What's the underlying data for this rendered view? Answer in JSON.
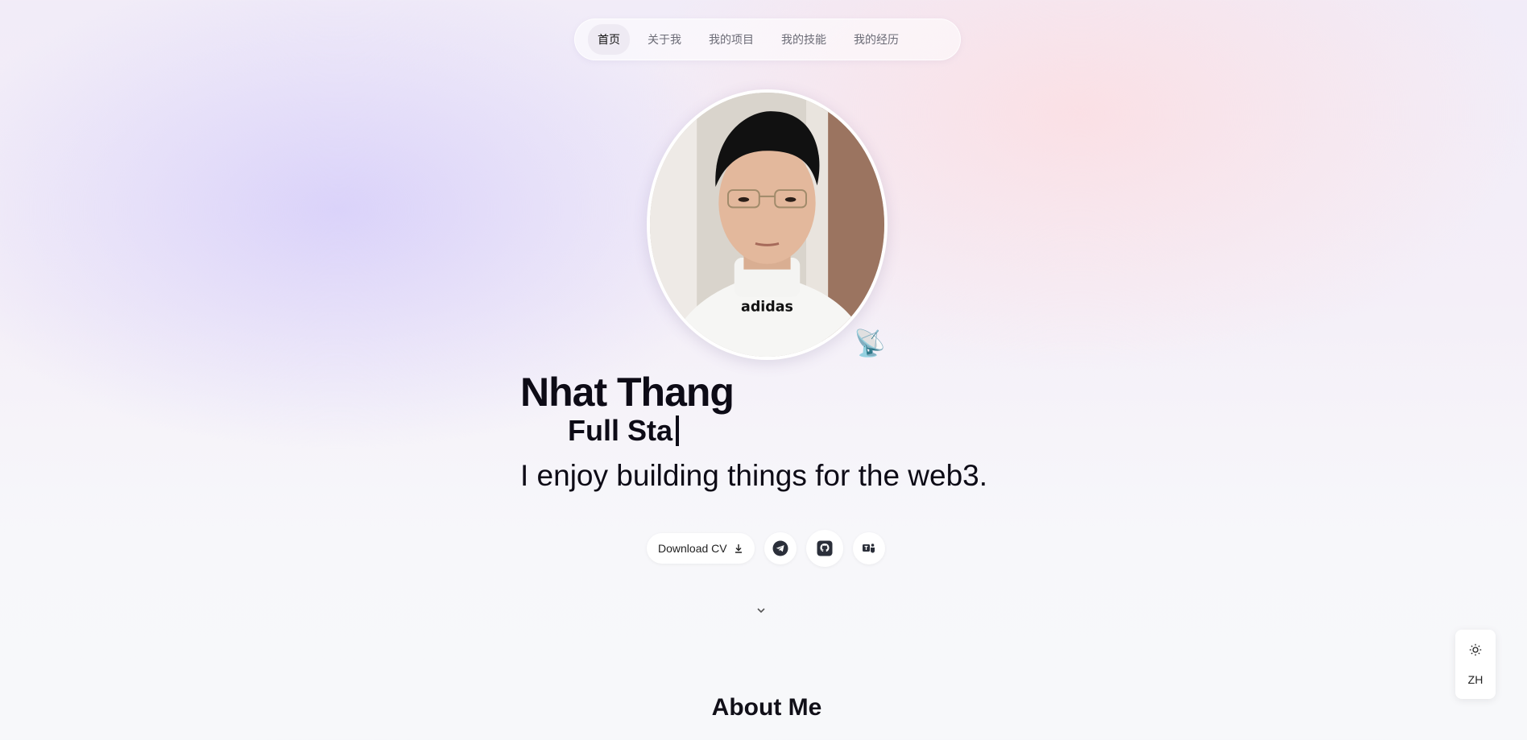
{
  "nav": {
    "items": [
      {
        "label": "首页",
        "active": true
      },
      {
        "label": "关于我",
        "active": false
      },
      {
        "label": "我的项目",
        "active": false
      },
      {
        "label": "我的技能",
        "active": false
      },
      {
        "label": "我的经历",
        "active": false
      }
    ]
  },
  "hero": {
    "name": "Nhat Thang",
    "role_typed": "Full Sta",
    "tagline": "I enjoy building things for the web3.",
    "badge_icon": "satellite-dish-icon"
  },
  "actions": {
    "download_label": "Download CV",
    "icons": [
      "telegram-icon",
      "github-icon",
      "teams-icon"
    ]
  },
  "sections": {
    "about_title": "About Me"
  },
  "side": {
    "theme_icon": "sun-icon",
    "lang_label": "ZH"
  },
  "colors": {
    "text": "#0d0b16",
    "muted": "#6b6b76",
    "accent_purple": "#d6cefa",
    "accent_pink": "#fcdee2"
  }
}
